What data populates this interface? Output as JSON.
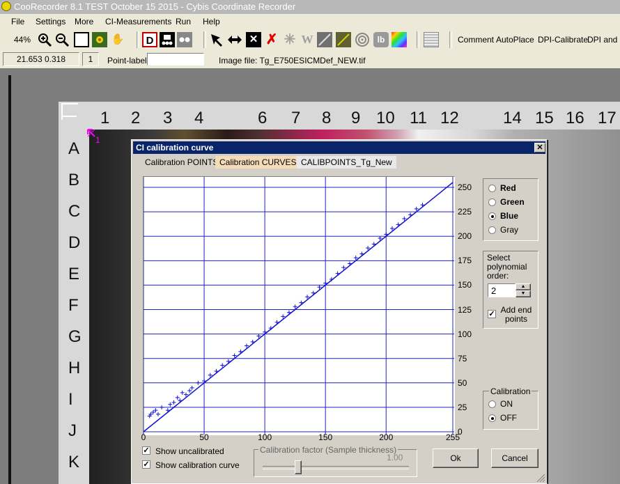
{
  "window": {
    "title": "CooRecorder 8.1 TEST October 15 2015 - Cybis Coordinate Recorder"
  },
  "menu": [
    "File",
    "Settings",
    "More",
    "CI-Measurements",
    "Run",
    "Help"
  ],
  "toolbar": {
    "zoom": "44%",
    "buttons": [
      "zoom-in-icon",
      "zoom-out-icon",
      "frame-icon",
      "yellow-flower-icon",
      "hand-icon",
      "d-mode-icon",
      "dots-icon",
      "two-dots-icon",
      "arrow-icon",
      "double-arrow-icon",
      "x-box-icon",
      "red-x-icon",
      "asterisk-icon",
      "w-icon",
      "diagonal-icon",
      "target-icon",
      "lb-icon",
      "color-wheel-icon",
      "tile-icon"
    ],
    "text_buttons": [
      "Comment",
      "AutoPlace",
      "DPI-Calibrate",
      "DPI and c"
    ]
  },
  "status": {
    "coords": "21.653  0.318",
    "point_count": "1",
    "point_label_caption": "Point-label:",
    "point_label_value": "",
    "image_file": "Image file: Tg_E750ESICMDef_NEW.tif"
  },
  "card": {
    "columns": [
      "1",
      "2",
      "3",
      "4",
      "6",
      "7",
      "8",
      "9",
      "10",
      "11",
      "12",
      "14",
      "15",
      "16",
      "17"
    ],
    "rows": [
      "A",
      "B",
      "C",
      "D",
      "E",
      "F",
      "G",
      "H",
      "I",
      "J",
      "K"
    ],
    "marker_label": "1"
  },
  "dialog": {
    "title": "CI calibration curve",
    "close_label": "✕",
    "tabs": [
      {
        "label": "Calibration POINTS",
        "active": false
      },
      {
        "label": "Calibration CURVES",
        "active": true
      },
      {
        "label": "CALIBPOINTS_Tg_New",
        "active": false
      }
    ],
    "channels": [
      {
        "label": "Red",
        "selected": false
      },
      {
        "label": "Green",
        "selected": false
      },
      {
        "label": "Blue",
        "selected": true
      },
      {
        "label": "Gray",
        "selected": false
      }
    ],
    "poly_label": "Select polynomial order:",
    "poly_value": "2",
    "add_end_points": "Add end points",
    "calibration_group": "Calibration",
    "calib_on": "ON",
    "calib_off": "OFF",
    "show_uncalibrated": "Show uncalibrated",
    "show_curve": "Show calibration curve",
    "factor_label": "Calibration factor (Sample thickness)",
    "factor_value": "1.00",
    "ok": "Ok",
    "cancel": "Cancel"
  },
  "chart_data": {
    "type": "scatter",
    "xlim": [
      0,
      255
    ],
    "ylim": [
      0,
      255
    ],
    "x_ticks": [
      "0",
      "50",
      "100",
      "150",
      "200",
      "255"
    ],
    "y_ticks": [
      "0",
      "25",
      "50",
      "75",
      "100",
      "125",
      "150",
      "175",
      "200",
      "225",
      "250"
    ],
    "grid": true,
    "line": {
      "x": [
        0,
        255
      ],
      "y": [
        0,
        255
      ]
    },
    "series": [
      {
        "marker": "+",
        "points": [
          [
            5,
            16
          ],
          [
            6,
            18
          ],
          [
            8,
            20
          ],
          [
            10,
            22
          ],
          [
            12,
            18
          ],
          [
            15,
            25
          ],
          [
            20,
            22
          ],
          [
            22,
            28
          ],
          [
            25,
            30
          ],
          [
            28,
            35
          ],
          [
            30,
            32
          ],
          [
            32,
            40
          ],
          [
            35,
            38
          ],
          [
            38,
            42
          ],
          [
            40,
            45
          ],
          [
            45,
            50
          ],
          [
            50,
            52
          ],
          [
            55,
            58
          ],
          [
            60,
            62
          ],
          [
            65,
            68
          ],
          [
            70,
            72
          ],
          [
            75,
            78
          ],
          [
            80,
            82
          ],
          [
            85,
            88
          ],
          [
            90,
            92
          ],
          [
            95,
            98
          ],
          [
            100,
            102
          ],
          [
            105,
            106
          ],
          [
            110,
            112
          ],
          [
            115,
            118
          ],
          [
            120,
            122
          ],
          [
            125,
            128
          ],
          [
            130,
            132
          ],
          [
            135,
            138
          ],
          [
            140,
            142
          ],
          [
            145,
            148
          ],
          [
            150,
            152
          ],
          [
            155,
            156
          ],
          [
            160,
            162
          ],
          [
            165,
            168
          ],
          [
            170,
            172
          ],
          [
            175,
            178
          ],
          [
            180,
            182
          ],
          [
            185,
            188
          ],
          [
            190,
            192
          ],
          [
            195,
            198
          ],
          [
            200,
            202
          ],
          [
            205,
            208
          ],
          [
            210,
            212
          ],
          [
            215,
            218
          ],
          [
            220,
            222
          ],
          [
            225,
            228
          ],
          [
            230,
            232
          ]
        ]
      }
    ]
  }
}
